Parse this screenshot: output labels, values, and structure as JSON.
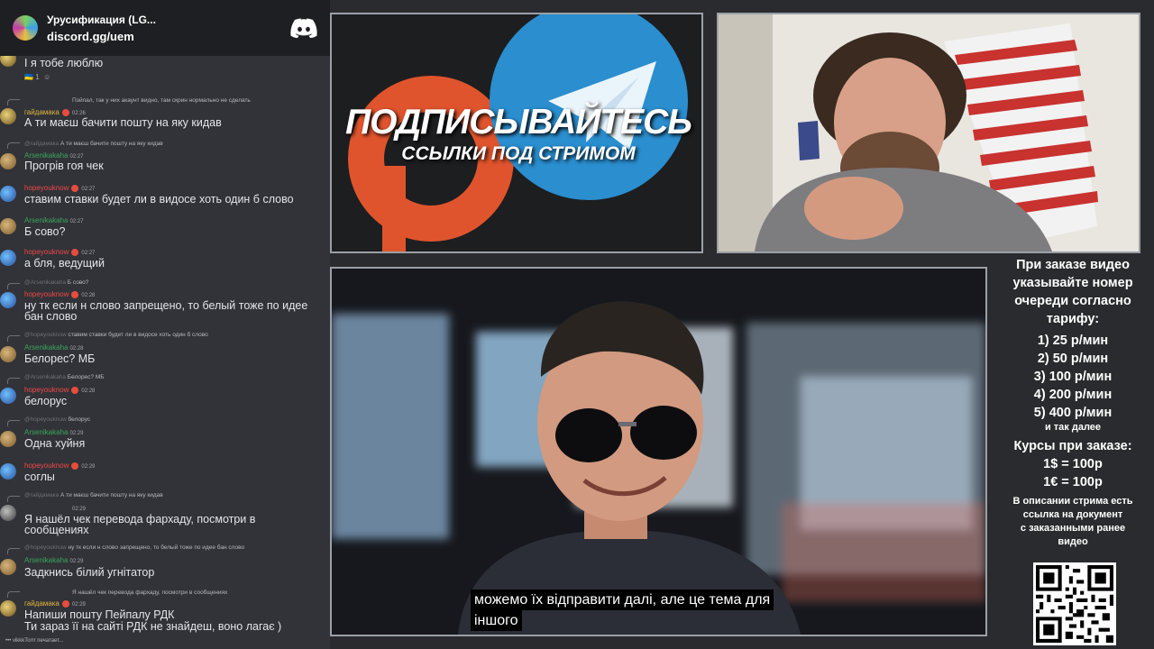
{
  "chat_header": {
    "server": "Урусификация (LG...",
    "invite": "discord.gg/uem"
  },
  "messages": [
    {
      "type": "cont",
      "text": "І я тобе люблю",
      "reactions": "1"
    },
    {
      "type": "reply",
      "reply_user": "",
      "reply_text": "Пэйпал, так у них акаунт видно, там скрин нормально не сделать",
      "user": "гайдамака",
      "time": "02:26",
      "text": "А ти маєш бачити пошту на яку кидав"
    },
    {
      "type": "reply",
      "reply_user": "@гайдамака",
      "reply_text": "А ти маєш бачити пошту на яку кидав",
      "user": "Arsenikakaha",
      "time": "02:27",
      "text": "Прогрів гоя чек"
    },
    {
      "type": "msg",
      "user": "hopeyouknow",
      "time": "02:27",
      "text": "ставим ставки будет ли в видосе хоть один б слово"
    },
    {
      "type": "msg",
      "user": "Arsenikakaha",
      "time": "02:27",
      "text": "Б сово?"
    },
    {
      "type": "msg",
      "user": "hopeyouknow",
      "time": "02:27",
      "text": "а бля, ведущий"
    },
    {
      "type": "reply",
      "reply_user": "@Arsenikakaha",
      "reply_text": "Б сово?",
      "user": "hopeyouknow",
      "time": "02:28",
      "text": "ну тк если н слово запрещено, то белый тоже по идее",
      "text2": "бан слово"
    },
    {
      "type": "reply",
      "reply_user": "@hopeyouknow",
      "reply_text": "ставим ставки будет ли в видосе хоть один б слово",
      "user": "Arsenikakaha",
      "time": "02:28",
      "text": "Белорес? МБ"
    },
    {
      "type": "reply",
      "reply_user": "@Arsenikakaha",
      "reply_text": "Белорес? МБ",
      "user": "hopeyouknow",
      "time": "02:28",
      "text": "белорус"
    },
    {
      "type": "reply",
      "reply_user": "@hopeyouknow",
      "reply_text": "белорус",
      "user": "Arsenikakaha",
      "time": "02:29",
      "text": "Одна хуйня"
    },
    {
      "type": "msg",
      "user": "hopeyouknow",
      "time": "02:29",
      "text": "соглы"
    },
    {
      "type": "reply",
      "reply_user": "@гайдамака",
      "reply_text": "А ти маєш бачити пошту на яку кидав",
      "user": "",
      "time": "02:29",
      "text": "Я нашёл чек перевода фархаду, посмотри в",
      "text2": "сообщениях"
    },
    {
      "type": "reply",
      "reply_user": "@hopeyouknow",
      "reply_text": "ну тк если н слово запрещено, то белый тоже по идее бан слово",
      "user": "Arsenikakaha",
      "time": "02:29",
      "text": "Задкнись білий угнітатор"
    },
    {
      "type": "reply",
      "reply_user": "",
      "reply_text": "Я нашёл чек перевода фархаду, посмотри в сообщениях",
      "user": "гайдамака",
      "time": "02:29",
      "text": "Напиши пошту Пейпалу РДК",
      "text2": "Ти зараз її на сайті РДК не знайдеш, воно лагає )"
    }
  ],
  "typing": "vikkkTorrr печатает...",
  "promo": {
    "title": "ПОДПИСЫВАЙТЕСЬ",
    "subtitle": "ССЫЛКИ ПОД СТРИМОМ"
  },
  "sidebar": {
    "intro": [
      "При заказе видео",
      "указывайте номер",
      "очереди согласно",
      "тарифу:"
    ],
    "tariffs": [
      "1) 25 р/мин",
      "2) 50 р/мин",
      "3) 100 р/мин",
      "4) 200 р/мин",
      "5) 400 р/мин"
    ],
    "etc": "и так далее",
    "rates_title": "Курсы при заказе:",
    "rates": [
      "1$ = 100р",
      "1€ = 100р"
    ],
    "desc": [
      "В описании стрима есть",
      "ссылка на документ",
      "с заказанными ранее",
      "видео"
    ]
  },
  "subtitle": [
    "можемо їх відправити далі, але це тема для",
    "іншого"
  ],
  "colors": {
    "discord_bg": "#313338",
    "header_bg": "#1e1f22",
    "username_green": "#3ba55c",
    "username_red": "#f04747",
    "username_gold": "#e2b53d",
    "telegram_blue": "#2a8ecf",
    "patreon_orange": "#e0542d"
  }
}
